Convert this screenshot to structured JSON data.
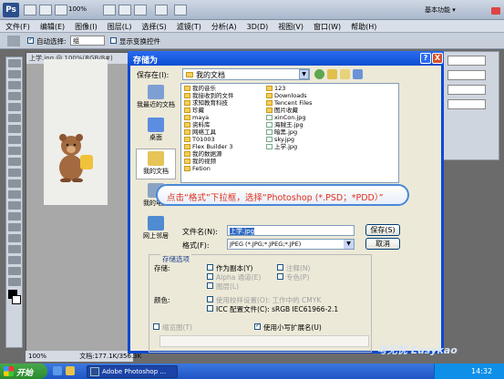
{
  "photoshop": {
    "logo": "Ps",
    "zoom": "100%",
    "workspace": "基本功能 ▾",
    "menus": [
      "文件(F)",
      "编辑(E)",
      "图像(I)",
      "图层(L)",
      "选择(S)",
      "滤镜(T)",
      "分析(A)",
      "3D(D)",
      "视图(V)",
      "窗口(W)",
      "帮助(H)"
    ],
    "options": {
      "auto_select": "自动选择:",
      "auto_select_value": "组",
      "show_transform": "显示变换控件"
    },
    "doc_tab": "上学.jpg @ 100%(RGB/8#)",
    "status_zoom": "100%",
    "status_doc": "文档:177.1K/356.3K"
  },
  "dialog": {
    "title": "存储为",
    "help_btn": "?",
    "close_btn": "X",
    "save_in_label": "保存在(I):",
    "save_in_value": "我的文档",
    "places": [
      "我最近的文档",
      "桌面",
      "我的文档",
      "我的电脑",
      "网上邻居"
    ],
    "files_col1": [
      "我的音乐",
      "我接收到的文件",
      "求知教育科技",
      "珍藏",
      "maya",
      "资料库",
      "网络工具",
      "T01003",
      "Flex Builder 3",
      "我的数据源",
      "我的视频",
      "Fetion"
    ],
    "files_col2": [
      "123",
      "Downloads",
      "Tencent Files",
      "图片收藏",
      "xinCon.jpg",
      "海贼王.jpg",
      "暗黑.jpg",
      "sky.jpg",
      "上学.jpg"
    ],
    "callout": "点击“格式”下拉框，选择“Photoshop (*.PSD；*PDD）”",
    "filename_label": "文件名(N):",
    "filename_value": "上学.jpg",
    "format_label": "格式(F):",
    "format_value": "JPEG (*.JPG;*.JPEG;*.JPE)",
    "save_btn": "保存(S)",
    "cancel_btn": "取消",
    "options_title": "存储选项",
    "storage_label": "存储:",
    "as_copy": "作为副本(Y)",
    "alpha": "Alpha 通道(E)",
    "layers": "图层(L)",
    "notes": "注释(N)",
    "spot": "专色(P)",
    "color_label": "颜色:",
    "proof": "使用校样设置(O): 工作中的 CMYK",
    "icc": "ICC 配置文件(C): sRGB IEC61966-2.1",
    "thumbnail": "缩览图(T)",
    "lowercase_ext": "使用小写扩展名(U)"
  },
  "taskbar": {
    "start": "开始",
    "task": "Adobe Photoshop ...",
    "clock": "14:32"
  },
  "watermark": "考无忧 Easykao"
}
